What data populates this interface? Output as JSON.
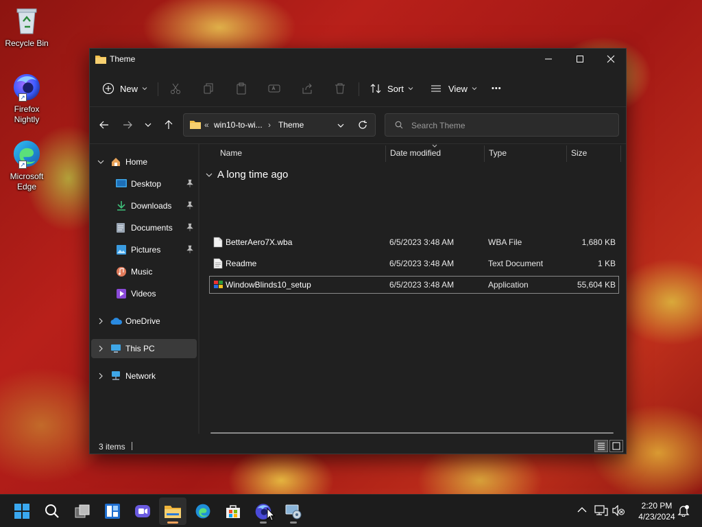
{
  "desktop": {
    "icons": [
      {
        "label": "Recycle Bin"
      },
      {
        "label": "Firefox\nNightly",
        "line1": "Firefox",
        "line2": "Nightly"
      },
      {
        "label": "Microsoft Edge",
        "line1": "Microsoft",
        "line2": "Edge"
      }
    ]
  },
  "window": {
    "title": "Theme",
    "caption": {
      "minimize": "–",
      "maximize": "☐",
      "close": "✕"
    },
    "toolbar": {
      "new_label": "New",
      "sort_label": "Sort",
      "view_label": "View",
      "more_label": "•••"
    },
    "address": {
      "overflow": "«",
      "crumbs": [
        "win10-to-wi...",
        "Theme"
      ],
      "separator": "›"
    },
    "search": {
      "placeholder": "Search Theme"
    },
    "nav": {
      "home": "Home",
      "quick": [
        "Desktop",
        "Downloads",
        "Documents",
        "Pictures",
        "Music",
        "Videos"
      ],
      "onedrive": "OneDrive",
      "thispc": "This PC",
      "network": "Network"
    },
    "columns": {
      "name": "Name",
      "date": "Date modified",
      "type": "Type",
      "size": "Size"
    },
    "group": "A long time ago",
    "files": [
      {
        "name": "BetterAero7X.wba",
        "date": "6/5/2023 3:48 AM",
        "type": "WBA File",
        "size": "1,680 KB"
      },
      {
        "name": "Readme",
        "date": "6/5/2023 3:48 AM",
        "type": "Text Document",
        "size": "1 KB"
      },
      {
        "name": "WindowBlinds10_setup",
        "date": "6/5/2023 3:48 AM",
        "type": "Application",
        "size": "55,604 KB"
      }
    ],
    "status": {
      "count": "3 items"
    }
  },
  "taskbar": {
    "apps": [
      "start-icon",
      "search-icon",
      "task-view-icon",
      "widgets-icon",
      "chat-icon",
      "file-explorer-icon",
      "edge-icon",
      "store-icon",
      "firefox-nightly-icon",
      "control-panel-icon"
    ],
    "clock": {
      "time": "2:20 PM",
      "date": "4/23/2024"
    }
  },
  "colors": {
    "accent": "#f7a35c",
    "folder": "#f3c04a",
    "window_bg": "#202020",
    "taskbar_bg": "#1c1c1c"
  }
}
